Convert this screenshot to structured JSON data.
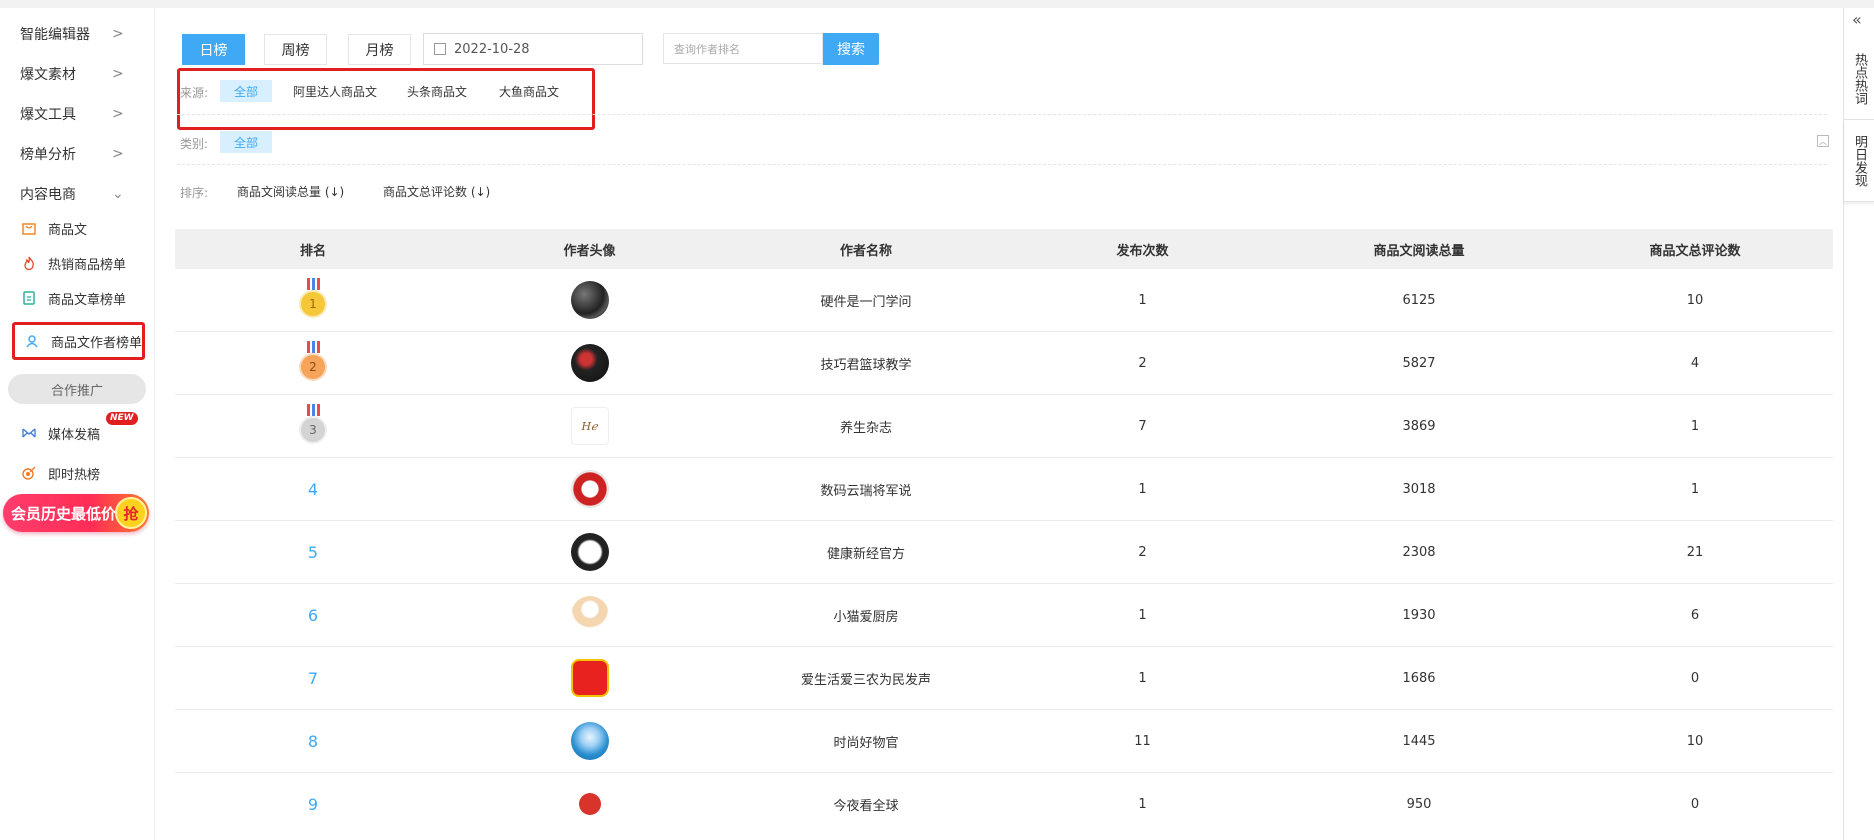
{
  "sidebar": {
    "menus": [
      {
        "label": "智能编辑器",
        "chevron": ">"
      },
      {
        "label": "爆文素材",
        "chevron": ">"
      },
      {
        "label": "爆文工具",
        "chevron": ">"
      },
      {
        "label": "榜单分析",
        "chevron": ">"
      },
      {
        "label": "内容电商",
        "chevron": "⌄"
      }
    ],
    "sub_items": [
      {
        "label": "商品文",
        "icon": "bag-icon"
      },
      {
        "label": "热销商品榜单",
        "icon": "flame-icon"
      },
      {
        "label": "商品文章榜单",
        "icon": "doc-icon"
      },
      {
        "label": "商品文作者榜单",
        "icon": "user-icon"
      }
    ],
    "promo_pill": "合作推广",
    "media": {
      "label": "媒体发稿",
      "badge": "NEW"
    },
    "hot": {
      "label": "即时热榜"
    },
    "vip_banner": {
      "text": "会员历史最低价",
      "grab": "抢"
    }
  },
  "toolbar": {
    "tabs": [
      "日榜",
      "周榜",
      "月榜"
    ],
    "active_tab": "日榜",
    "date": "2022-10-28",
    "search_placeholder": "查询作者排名",
    "search_label": "搜索"
  },
  "filters": {
    "source_label": "来源:",
    "sources": [
      "全部",
      "阿里达人商品文",
      "头条商品文",
      "大鱼商品文"
    ],
    "category_label": "类别:",
    "categories": [
      "全部"
    ],
    "sort_label": "排序:",
    "sorts": [
      "商品文阅读总量 (↓)",
      "商品文总评论数 (↓)"
    ]
  },
  "table": {
    "columns": [
      "排名",
      "作者头像",
      "作者名称",
      "发布次数",
      "商品文阅读总量",
      "商品文总评论数"
    ],
    "rows": [
      {
        "rank": "1",
        "name": "硬件是一门学问",
        "posts": "1",
        "reads": "6125",
        "comments": "10"
      },
      {
        "rank": "2",
        "name": "技巧君篮球教学",
        "posts": "2",
        "reads": "5827",
        "comments": "4"
      },
      {
        "rank": "3",
        "name": "养生杂志",
        "posts": "7",
        "reads": "3869",
        "comments": "1"
      },
      {
        "rank": "4",
        "name": "数码云瑞将军说",
        "posts": "1",
        "reads": "3018",
        "comments": "1"
      },
      {
        "rank": "5",
        "name": "健康新经官方",
        "posts": "2",
        "reads": "2308",
        "comments": "21"
      },
      {
        "rank": "6",
        "name": "小猫爱厨房",
        "posts": "1",
        "reads": "1930",
        "comments": "6"
      },
      {
        "rank": "7",
        "name": "爱生活爱三农为民发声",
        "posts": "1",
        "reads": "1686",
        "comments": "0"
      },
      {
        "rank": "8",
        "name": "时尚好物官",
        "posts": "11",
        "reads": "1445",
        "comments": "10"
      },
      {
        "rank": "9",
        "name": "今夜看全球",
        "posts": "1",
        "reads": "950",
        "comments": "0"
      }
    ]
  },
  "rail": {
    "collapse": "«",
    "tabs": [
      "热点热词",
      "明日发现"
    ]
  },
  "colors": {
    "accent": "#3fa9f5",
    "highlight_border": "#e02020"
  }
}
